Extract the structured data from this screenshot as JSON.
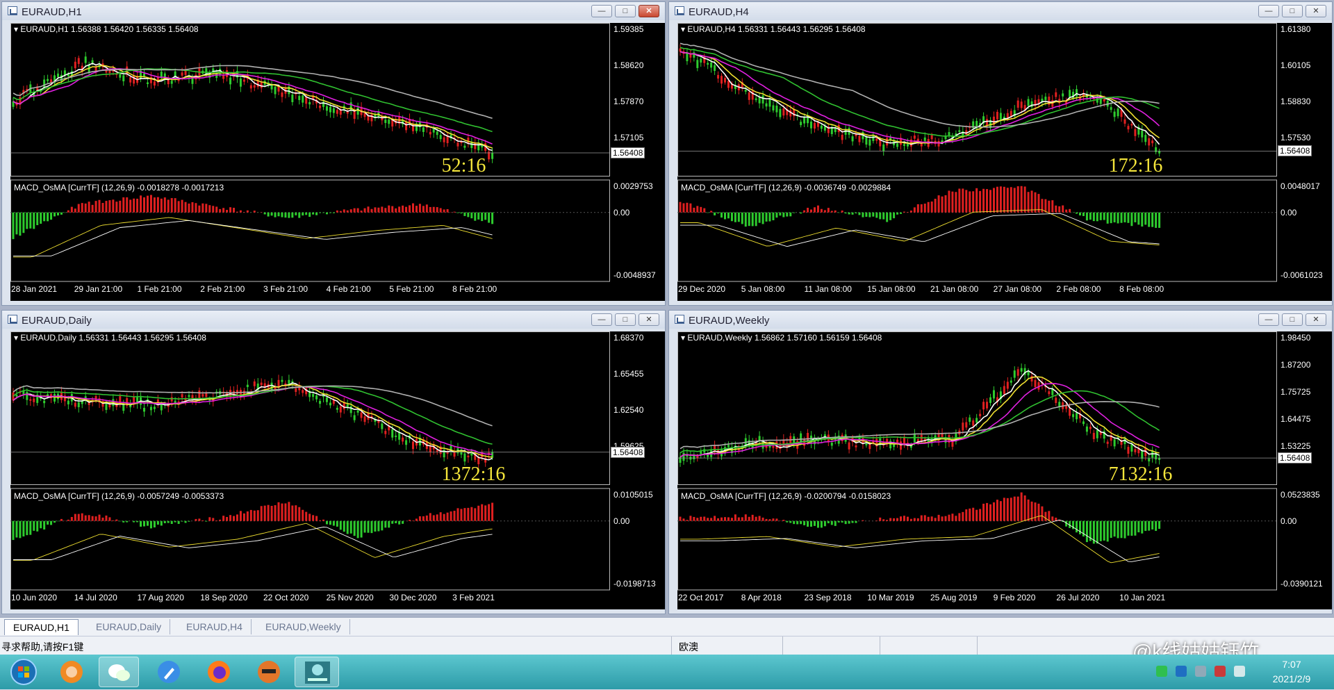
{
  "windows": [
    {
      "title": "EURAUD,H1",
      "header": "EURAUD,H1  1.56388 1.56420 1.56335 1.56408",
      "yticks": [
        "1.59385",
        "1.58620",
        "1.57870",
        "1.57105"
      ],
      "price_tag": "1.56408",
      "timer": "52:16",
      "macd_label": "MACD_OsMA [CurrTF] (12,26,9) -0.0018278 -0.0017213",
      "macd_yticks": [
        "0.0029753",
        "0.00",
        "-0.0048937"
      ],
      "xticks": [
        "28 Jan 2021",
        "29 Jan 21:00",
        "1 Feb 21:00",
        "2 Feb 21:00",
        "3 Feb 21:00",
        "4 Feb 21:00",
        "5 Feb 21:00",
        "8 Feb 21:00"
      ],
      "close_active": true
    },
    {
      "title": "EURAUD,H4",
      "header": "EURAUD,H4  1.56331 1.56443 1.56295 1.56408",
      "yticks": [
        "1.61380",
        "1.60105",
        "1.58830",
        "1.57530"
      ],
      "price_tag": "1.56408",
      "timer": "172:16",
      "macd_label": "MACD_OsMA [CurrTF] (12,26,9) -0.0036749 -0.0029884",
      "macd_yticks": [
        "0.0048017",
        "0.00",
        "-0.0061023"
      ],
      "xticks": [
        "29 Dec 2020",
        "5 Jan 08:00",
        "11 Jan 08:00",
        "15 Jan 08:00",
        "21 Jan 08:00",
        "27 Jan 08:00",
        "2 Feb 08:00",
        "8 Feb 08:00"
      ],
      "close_active": false
    },
    {
      "title": "EURAUD,Daily",
      "header": "EURAUD,Daily  1.56331 1.56443 1.56295 1.56408",
      "yticks": [
        "1.68370",
        "1.65455",
        "1.62540",
        "1.59625"
      ],
      "price_tag": "1.56408",
      "timer": "1372:16",
      "macd_label": "MACD_OsMA [CurrTF] (12,26,9) -0.0057249 -0.0053373",
      "macd_yticks": [
        "0.0105015",
        "0.00",
        "-0.0198713"
      ],
      "xticks": [
        "10 Jun 2020",
        "14 Jul 2020",
        "17 Aug 2020",
        "18 Sep 2020",
        "22 Oct 2020",
        "25 Nov 2020",
        "30 Dec 2020",
        "3 Feb 2021"
      ],
      "close_active": false
    },
    {
      "title": "EURAUD,Weekly",
      "header": "EURAUD,Weekly  1.56862 1.57160 1.56159 1.56408",
      "yticks": [
        "1.98450",
        "1.87200",
        "1.75725",
        "1.64475",
        "1.53225"
      ],
      "price_tag": "1.56408",
      "timer": "7132:16",
      "macd_label": "MACD_OsMA [CurrTF] (12,26,9) -0.0200794 -0.0158023",
      "macd_yticks": [
        "0.0523835",
        "0.00",
        "-0.0390121"
      ],
      "xticks": [
        "22 Oct 2017",
        "8 Apr 2018",
        "23 Sep 2018",
        "10 Mar 2019",
        "25 Aug 2019",
        "9 Feb 2020",
        "26 Jul 2020",
        "10 Jan 2021"
      ],
      "close_active": false
    }
  ],
  "tabs": [
    "EURAUD,H1",
    "EURAUD,Daily",
    "EURAUD,H4",
    "EURAUD,Weekly"
  ],
  "active_tab": 0,
  "status": {
    "help": "寻求帮助,请按F1键",
    "profile": "欧澳"
  },
  "clock": {
    "time": "7:07",
    "date": "2021/2/9"
  },
  "watermark": "@k线姑姑钰竹",
  "colors": {
    "bull": "#2ecc2e",
    "bear": "#e02020",
    "ma_fast": "#ffffff",
    "ma_yellow": "#f0e030",
    "ma_magenta": "#e020e0",
    "ma_green": "#30c030",
    "ma_gray": "#b0b0b0"
  }
}
